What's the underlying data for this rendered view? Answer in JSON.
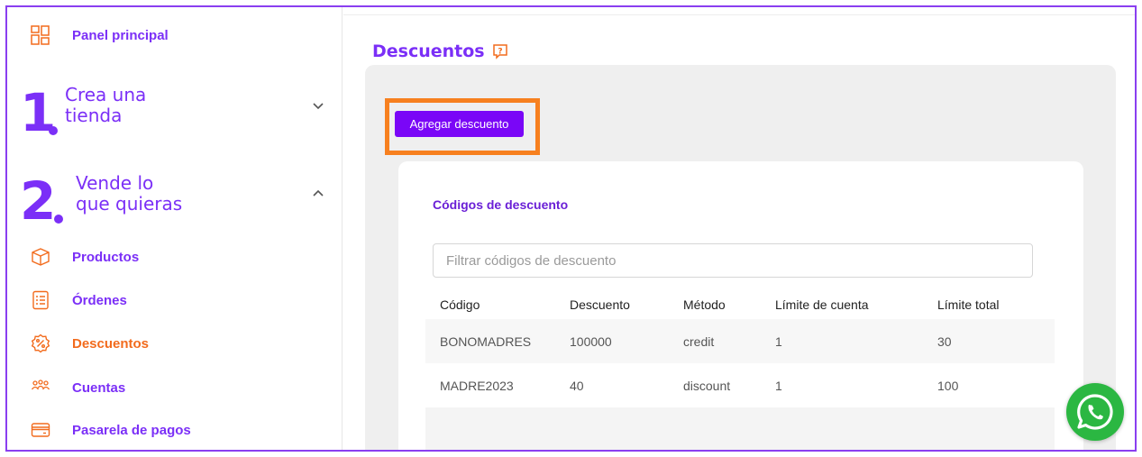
{
  "sidebar": {
    "panel_label": "Panel principal",
    "step1": {
      "number": "1",
      "line1": "Crea una",
      "line2": "tienda"
    },
    "step2": {
      "number": "2",
      "line1": "Vende lo",
      "line2": "que quieras"
    },
    "items": [
      {
        "label": "Productos",
        "icon": "box-icon"
      },
      {
        "label": "Órdenes",
        "icon": "orders-list-icon"
      },
      {
        "label": "Descuentos",
        "icon": "percent-badge-icon",
        "active": true
      },
      {
        "label": "Cuentas",
        "icon": "users-icon"
      },
      {
        "label": "Pasarela de pagos",
        "icon": "credit-card-icon"
      }
    ]
  },
  "main": {
    "title": "Descuentos",
    "add_button": "Agregar descuento",
    "card_title": "Códigos de descuento",
    "filter_placeholder": "Filtrar códigos de descuento",
    "table": {
      "headers": [
        "Código",
        "Descuento",
        "Método",
        "Límite de cuenta",
        "Límite total"
      ],
      "rows": [
        [
          "BONOMADRES",
          "100000",
          "credit",
          "1",
          "30"
        ],
        [
          "MADRE2023",
          "40",
          "discount",
          "1",
          "100"
        ]
      ]
    }
  },
  "colors": {
    "brand_purple": "#7b2ff7",
    "button_purple": "#7a06f7",
    "active_orange": "#f26b1d",
    "highlight_orange": "#f7801f",
    "whatsapp_green": "#2bb742"
  }
}
